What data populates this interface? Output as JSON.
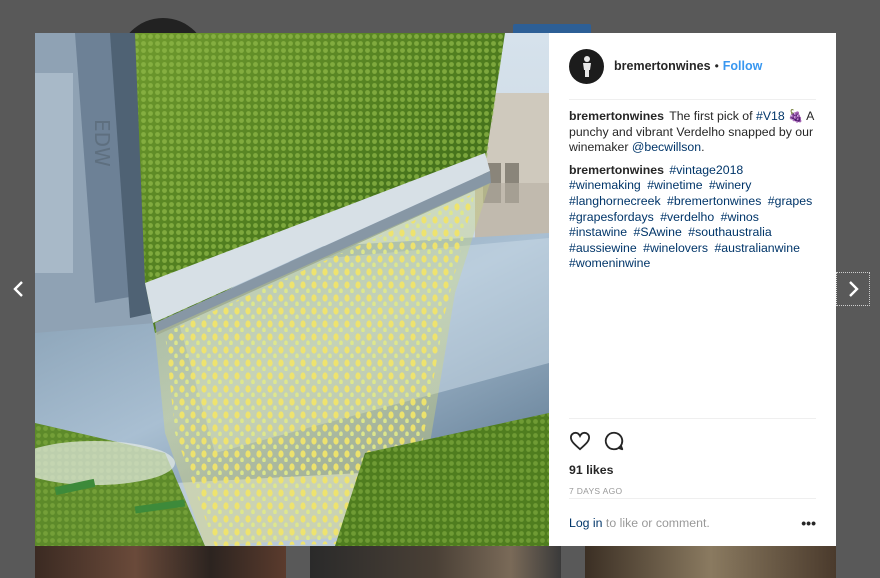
{
  "post": {
    "username": "bremertonwines",
    "separator": "•",
    "follow_label": "Follow",
    "caption": {
      "text_before": "The first pick of ",
      "hashtag": "#V18",
      "emoji": "🍇",
      "text_after": " A punchy and vibrant Verdelho snapped by our winemaker ",
      "mention": "@becwillson",
      "end": "."
    },
    "comment": {
      "username": "bremertonwines",
      "hashtags": [
        "#vintage2018",
        "#winemaking",
        "#winetime",
        "#winery",
        "#langhornecreek",
        "#bremertonwines",
        "#grapes",
        "#grapesfordays",
        "#verdelho",
        "#winos",
        "#instawine",
        "#SAwine",
        "#southaustralia",
        "#aussiewine",
        "#winelovers",
        "#australianwine",
        "#womeninwine"
      ]
    },
    "likes": "91 likes",
    "timestamp": "7 DAYS AGO",
    "login_link": "Log in",
    "login_rest": " to like or comment.",
    "more_label": "•••"
  },
  "icons": {
    "like": "heart-icon",
    "comment": "comment-bubble-icon",
    "prev": "chevron-left-icon",
    "next": "chevron-right-icon",
    "more": "more-options-icon"
  },
  "colors": {
    "link": "#003569",
    "follow": "#3897f0",
    "text": "#262626",
    "muted": "#999999",
    "overlay": "#595959"
  }
}
